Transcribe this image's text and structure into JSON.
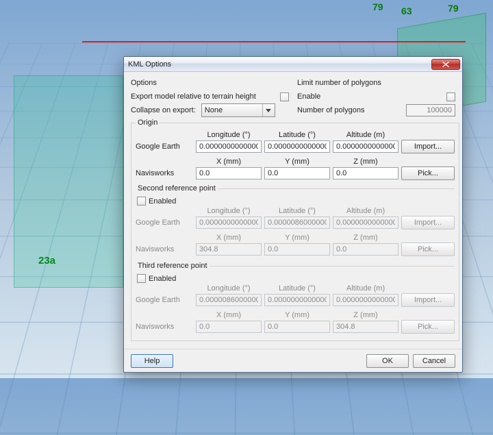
{
  "background": {
    "labels": {
      "top_79a": "79",
      "top_63": "63",
      "top_79b": "79",
      "left_23a": "23a"
    }
  },
  "dialog": {
    "title": "KML Options",
    "options": {
      "heading": "Options",
      "export_relative_label": "Export model relative to terrain height",
      "collapse_label": "Collapse on export:",
      "collapse_value": "None"
    },
    "polygons": {
      "heading": "Limit number of polygons",
      "enable_label": "Enable",
      "count_label": "Number of polygons",
      "count_value": "100000"
    },
    "origin": {
      "legend": "Origin",
      "ge_label": "Google Earth",
      "nw_label": "Navisworks",
      "cols_geo": {
        "lon": "Longitude (°)",
        "lat": "Latitude (°)",
        "alt": "Altitude (m)"
      },
      "cols_xyz": {
        "x": "X (mm)",
        "y": "Y (mm)",
        "z": "Z (mm)"
      },
      "geo": {
        "lon": "0.00000000000000",
        "lat": "0.00000000000000",
        "alt": "0.00000000000000"
      },
      "xyz": {
        "x": "0.0",
        "y": "0.0",
        "z": "0.0"
      },
      "import_btn": "Import...",
      "pick_btn": "Pick..."
    },
    "ref2": {
      "legend": "Second reference point",
      "enabled_label": "Enabled",
      "ge_label": "Google Earth",
      "nw_label": "Navisworks",
      "cols_geo": {
        "lon": "Longitude (°)",
        "lat": "Latitude (°)",
        "alt": "Altitude (m)"
      },
      "cols_xyz": {
        "x": "X (mm)",
        "y": "Y (mm)",
        "z": "Z (mm)"
      },
      "geo": {
        "lon": "0.00000000000000",
        "lat": "0.00000860000000",
        "alt": "0.00000000000000"
      },
      "xyz": {
        "x": "304.8",
        "y": "0.0",
        "z": "0.0"
      },
      "import_btn": "Import...",
      "pick_btn": "Pick..."
    },
    "ref3": {
      "legend": "Third reference point",
      "enabled_label": "Enabled",
      "ge_label": "Google Earth",
      "nw_label": "Navisworks",
      "cols_geo": {
        "lon": "Longitude (°)",
        "lat": "Latitude (°)",
        "alt": "Altitude (m)"
      },
      "cols_xyz": {
        "x": "X (mm)",
        "y": "Y (mm)",
        "z": "Z (mm)"
      },
      "geo": {
        "lon": "0.00000860000000",
        "lat": "0.00000000000000",
        "alt": "0.00000000000000"
      },
      "xyz": {
        "x": "0.0",
        "y": "0.0",
        "z": "304.8"
      },
      "import_btn": "Import...",
      "pick_btn": "Pick..."
    },
    "footer": {
      "help": "Help",
      "ok": "OK",
      "cancel": "Cancel"
    }
  }
}
